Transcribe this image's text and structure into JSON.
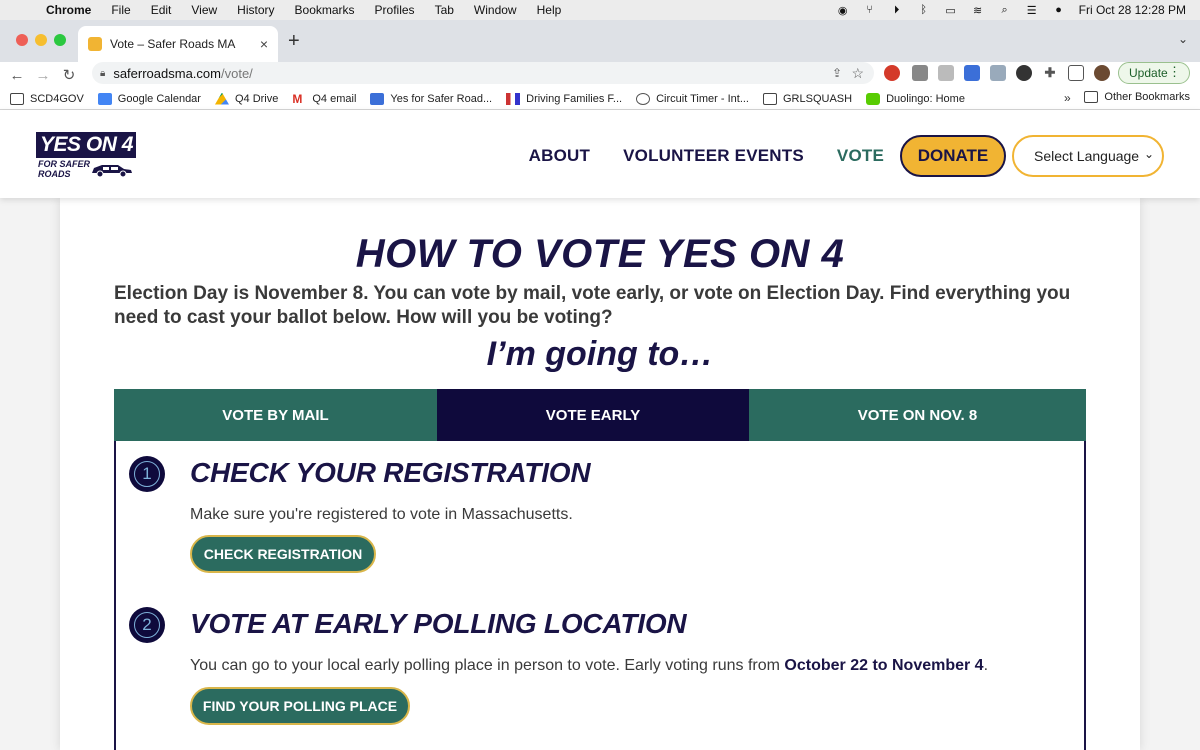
{
  "menubar": {
    "app": "Chrome",
    "items": [
      "File",
      "Edit",
      "View",
      "History",
      "Bookmarks",
      "Profiles",
      "Tab",
      "Window",
      "Help"
    ],
    "clock": "Fri Oct 28  12:28 PM"
  },
  "browser": {
    "tab_title": "Vote – Safer Roads MA",
    "url_host": "saferroadsma.com",
    "url_path": "/vote/",
    "update_label": "Update"
  },
  "bookmarks": {
    "items": [
      "SCD4GOV",
      "Google Calendar",
      "Q4 Drive",
      "Q4 email",
      "Yes for Safer Road...",
      "Driving Families F...",
      "Circuit Timer - Int...",
      "GRLSQUASH",
      "Duolingo: Home"
    ],
    "more": "»",
    "other": "Other Bookmarks"
  },
  "site": {
    "logo_main": "YES ON 4",
    "logo_sub_1": "FOR SAFER",
    "logo_sub_2": "ROADS",
    "nav": {
      "about": "ABOUT",
      "volunteer": "VOLUNTEER EVENTS",
      "vote": "VOTE",
      "donate": "DONATE",
      "language": "Select Language"
    }
  },
  "main": {
    "title": "HOW TO VOTE YES ON 4",
    "intro": "Election Day is November 8. You can vote by mail, vote early, or vote on Election Day. Find everything you need to cast your ballot below. How will you be voting?",
    "going_to": "I’m going to…",
    "tabs": [
      "VOTE BY MAIL",
      "VOTE EARLY",
      "VOTE ON NOV. 8"
    ],
    "steps": [
      {
        "num": "1",
        "title": "CHECK YOUR REGISTRATION",
        "text": "Make sure you're registered to vote in Massachusetts.",
        "button": "CHECK REGISTRATION"
      },
      {
        "num": "2",
        "title": "VOTE AT EARLY POLLING LOCATION",
        "text": "You can go to your local early polling place in person to vote. Early voting runs from ",
        "text_bold": "October 22 to November 4",
        "text_end": ".",
        "button": "FIND YOUR POLLING PLACE"
      }
    ]
  },
  "colors": {
    "navy": "#1a1446",
    "green": "#2b6b5f",
    "gold": "#f1b433",
    "dark_tab": "#0f0a3c"
  }
}
